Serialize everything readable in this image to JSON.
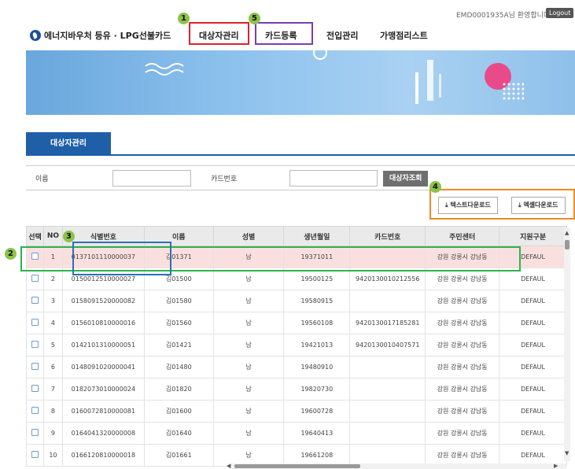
{
  "header": {
    "welcome": "EMD0001935A님 환영합니다",
    "logout": "Logout",
    "logo": "에너지바우처 등유 · LPG선불카드",
    "nav": [
      "대상자관리",
      "카드등록",
      "전입관리",
      "가맹점리스트"
    ]
  },
  "markers": [
    "1",
    "5",
    "2",
    "3",
    "4"
  ],
  "tab": "대상자관리",
  "search": {
    "name_label": "이름",
    "name_value": "",
    "card_label": "카드번호",
    "card_value": "",
    "search_button": "대상자조회"
  },
  "downloads": {
    "text": "텍스트다운로드",
    "excel": "엑셀다운로드",
    "icon": "download-icon"
  },
  "grid": {
    "headers": [
      "선택",
      "NO",
      "식별번호",
      "이름",
      "성별",
      "생년월일",
      "카드번호",
      "주민센터",
      "지원구분"
    ],
    "rows": [
      {
        "no": "1",
        "id": "0137101110000037",
        "name": "김01371",
        "gender": "남",
        "birth": "19371011",
        "card": "",
        "center": "강원 강릉시 강남동",
        "type": "DEFAUL"
      },
      {
        "no": "2",
        "id": "0150012510000027",
        "name": "김01500",
        "gender": "남",
        "birth": "19500125",
        "card": "9420130010212556",
        "center": "강원 강릉시 강남동",
        "type": "DEFAUL"
      },
      {
        "no": "3",
        "id": "0158091520000082",
        "name": "김01580",
        "gender": "남",
        "birth": "19580915",
        "card": "",
        "center": "강원 강릉시 강남동",
        "type": "DEFAUL"
      },
      {
        "no": "4",
        "id": "0156010810000016",
        "name": "김01560",
        "gender": "남",
        "birth": "19560108",
        "card": "9420130017185281",
        "center": "강원 강릉시 강남동",
        "type": "DEFAUL"
      },
      {
        "no": "5",
        "id": "0142101310000051",
        "name": "김01421",
        "gender": "남",
        "birth": "19421013",
        "card": "9420130010407571",
        "center": "강원 강릉시 강남동",
        "type": "DEFAUL"
      },
      {
        "no": "6",
        "id": "0148091020000041",
        "name": "김01480",
        "gender": "남",
        "birth": "19480910",
        "card": "",
        "center": "강원 강릉시 강남동",
        "type": "DEFAUL"
      },
      {
        "no": "7",
        "id": "0182073010000024",
        "name": "김01820",
        "gender": "남",
        "birth": "19820730",
        "card": "",
        "center": "강원 강릉시 강남동",
        "type": "DEFAUL"
      },
      {
        "no": "8",
        "id": "0160072810000081",
        "name": "김01600",
        "gender": "남",
        "birth": "19600728",
        "card": "",
        "center": "강원 강릉시 강남동",
        "type": "DEFAUL"
      },
      {
        "no": "9",
        "id": "0164041320000008",
        "name": "김01640",
        "gender": "남",
        "birth": "19640413",
        "card": "",
        "center": "강원 강릉시 강남동",
        "type": "DEFAUL"
      },
      {
        "no": "10",
        "id": "0166120810000018",
        "name": "김01661",
        "gender": "남",
        "birth": "19661208",
        "card": "",
        "center": "강원 강릉시 강남동",
        "type": "DEFAUL"
      }
    ]
  },
  "colors": {
    "primary": "#1e5fa8",
    "marker": "#8bc34a",
    "box_red": "#d9232e",
    "box_purple": "#7a3fb0",
    "box_green": "#2fb24c",
    "box_blue": "#2e6fb5",
    "box_orange": "#f08a24",
    "selected_row": "#f9e0de"
  }
}
